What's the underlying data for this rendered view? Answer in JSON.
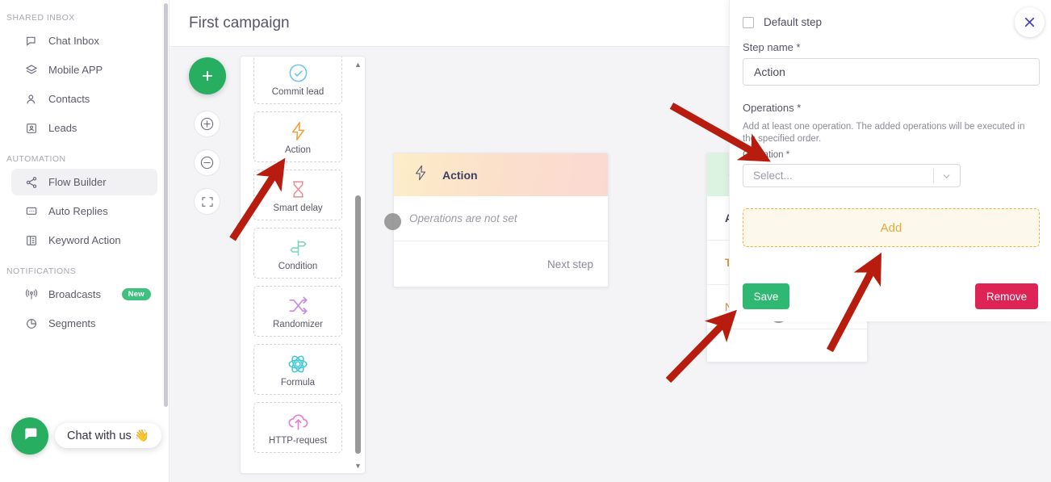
{
  "sidebar": {
    "sections": [
      {
        "title": "SHARED INBOX",
        "items": [
          {
            "label": "Chat Inbox",
            "icon": "chat-icon"
          },
          {
            "label": "Mobile APP",
            "icon": "layers-icon"
          },
          {
            "label": "Contacts",
            "icon": "person-icon"
          },
          {
            "label": "Leads",
            "icon": "id-card-icon"
          }
        ]
      },
      {
        "title": "AUTOMATION",
        "items": [
          {
            "label": "Flow Builder",
            "icon": "share-nodes-icon",
            "active": true
          },
          {
            "label": "Auto Replies",
            "icon": "message-dots-icon"
          },
          {
            "label": "Keyword Action",
            "icon": "columns-icon"
          }
        ]
      },
      {
        "title": "NOTIFICATIONS",
        "items": [
          {
            "label": "Broadcasts",
            "icon": "broadcast-icon",
            "badge": "New"
          },
          {
            "label": "Segments",
            "icon": "pie-chart-icon"
          }
        ]
      }
    ],
    "chat_widget": {
      "label": "Chat with us 👋",
      "icon": "chat-bubble-icon"
    }
  },
  "header": {
    "title": "First campaign"
  },
  "canvas": {
    "toolbar": {
      "add": "+",
      "zoom_in": "zoom-in",
      "zoom_out": "zoom-out",
      "fit": "fit-screen"
    },
    "palette": [
      {
        "label": "Commit lead",
        "icon": "check-circle-icon",
        "color": "#6ec3ef"
      },
      {
        "label": "Action",
        "icon": "lightning-icon",
        "color": "#f2a23c"
      },
      {
        "label": "Smart delay",
        "icon": "hourglass-icon",
        "color": "#f08a96"
      },
      {
        "label": "Condition",
        "icon": "signpost-icon",
        "color": "#7fd4bd"
      },
      {
        "label": "Randomizer",
        "icon": "shuffle-icon",
        "color": "#c48fd8"
      },
      {
        "label": "Formula",
        "icon": "atom-icon",
        "color": "#3ec9d6"
      },
      {
        "label": "HTTP-request",
        "icon": "cloud-upload-icon",
        "color": "#e17fd4"
      }
    ],
    "nodes": {
      "action": {
        "title": "Action",
        "icon": "lightning-icon",
        "body": "Operations are not set",
        "next": "Next step"
      },
      "condition": {
        "icon": "signpost-icon",
        "rows": [
          "Ag",
          "Ta",
          "No"
        ]
      }
    }
  },
  "panel": {
    "close_icon": "close-icon",
    "default_step": {
      "label": "Default step",
      "checked": false
    },
    "step_name": {
      "label": "Step name *",
      "value": "Action"
    },
    "operations": {
      "label": "Operations *",
      "hint": "Add at least one operation. The added operations will be executed in the specified order.",
      "operation_label": "Operation *",
      "select_placeholder": "Select...",
      "delete_icon": "trash-icon",
      "add_label": "Add"
    },
    "save_label": "Save",
    "remove_label": "Remove"
  },
  "colors": {
    "green": "#2eb871",
    "crimson": "#dd2455",
    "amber": "#e8a93a",
    "annotation_red": "#b71c0e",
    "close_blue": "#4242bf"
  }
}
